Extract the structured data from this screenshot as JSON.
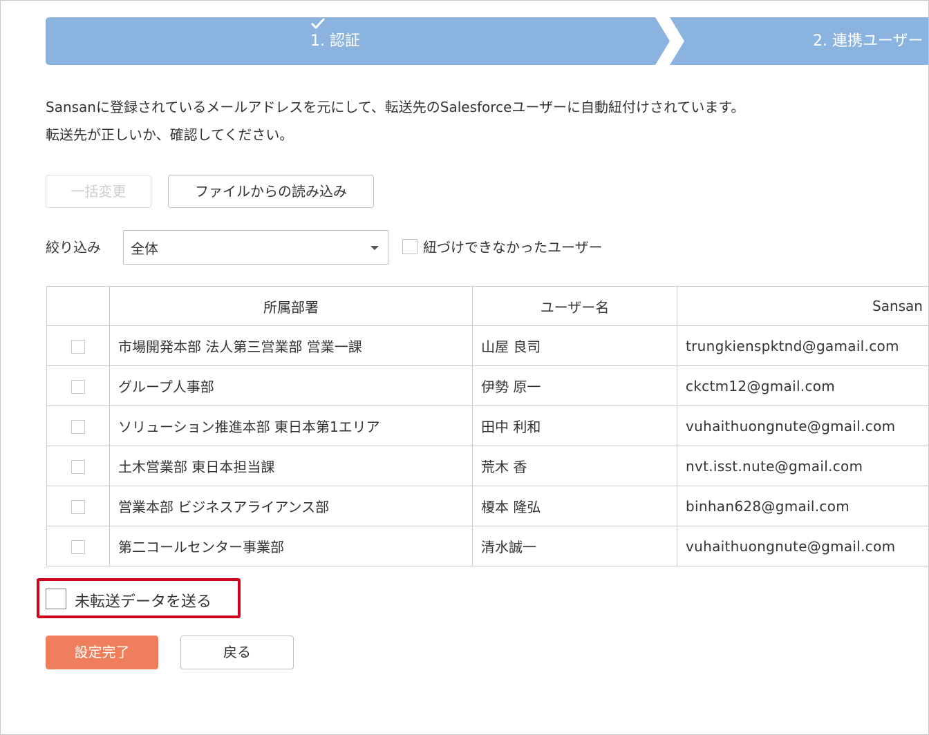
{
  "steps": [
    {
      "label": "1. 認証",
      "done": true
    },
    {
      "label": "2. 連携ユーザー"
    }
  ],
  "description": {
    "line1": "Sansanに登録されているメールアドレスを元にして、転送先のSalesforceユーザーに自動紐付けされています。",
    "line2": "転送先が正しいか、確認してください。"
  },
  "toolbar": {
    "bulk_change_label": "一括変更",
    "import_file_label": "ファイルからの読み込み"
  },
  "filter": {
    "label": "絞り込み",
    "selected": "全体",
    "unlinked_label": "紐づけできなかったユーザー"
  },
  "table": {
    "headers": {
      "dept": "所属部署",
      "user": "ユーザー名",
      "sansan": "Sansan"
    },
    "rows": [
      {
        "dept": "市場開発本部 法人第三営業部 営業一課",
        "user": "山屋 良司",
        "email": "trungkienspktnd@gamail.com"
      },
      {
        "dept": "グループ人事部",
        "user": "伊勢 原一",
        "email": "ckctm12@gmail.com"
      },
      {
        "dept": "ソリューション推進本部 東日本第1エリア",
        "user": "田中 利和",
        "email": "vuhaithuongnute@gmail.com"
      },
      {
        "dept": "土木営業部 東日本担当課",
        "user": "荒木 香",
        "email": "nvt.isst.nute@gmail.com"
      },
      {
        "dept": "営業本部 ビジネスアライアンス部",
        "user": "榎本 隆弘",
        "email": "binhan628@gmail.com"
      },
      {
        "dept": "第二コールセンター事業部",
        "user": "清水誠一",
        "email": "vuhaithuongnute@gmail.com"
      }
    ]
  },
  "send_unsent": {
    "label": "未転送データを送る"
  },
  "actions": {
    "complete_label": "設定完了",
    "back_label": "戻る"
  },
  "colors": {
    "step_bar": "#8ab3e0",
    "primary_button": "#ef7f5c",
    "highlight": "#d0021b"
  }
}
